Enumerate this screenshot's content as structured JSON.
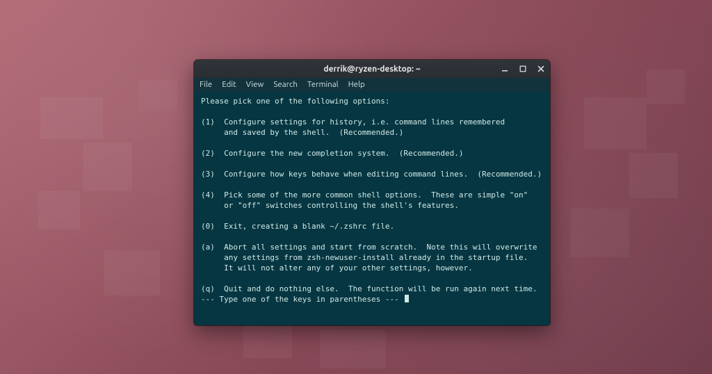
{
  "window": {
    "title": "derrik@ryzen-desktop: ~"
  },
  "menu": {
    "file": "File",
    "edit": "Edit",
    "view": "View",
    "search": "Search",
    "terminal": "Terminal",
    "help": "Help"
  },
  "lines": {
    "l0": "Please pick one of the following options:",
    "l1": "",
    "l2": "(1)  Configure settings for history, i.e. command lines remembered",
    "l3": "     and saved by the shell.  (Recommended.)",
    "l4": "",
    "l5": "(2)  Configure the new completion system.  (Recommended.)",
    "l6": "",
    "l7": "(3)  Configure how keys behave when editing command lines.  (Recommended.)",
    "l8": "",
    "l9": "(4)  Pick some of the more common shell options.  These are simple \"on\"",
    "l10": "     or \"off\" switches controlling the shell's features.",
    "l11": "",
    "l12": "(0)  Exit, creating a blank ~/.zshrc file.",
    "l13": "",
    "l14": "(a)  Abort all settings and start from scratch.  Note this will overwrite",
    "l15": "     any settings from zsh-newuser-install already in the startup file.",
    "l16": "     It will not alter any of your other settings, however.",
    "l17": "",
    "l18": "(q)  Quit and do nothing else.  The function will be run again next time.",
    "l19": "--- Type one of the keys in parentheses --- "
  }
}
